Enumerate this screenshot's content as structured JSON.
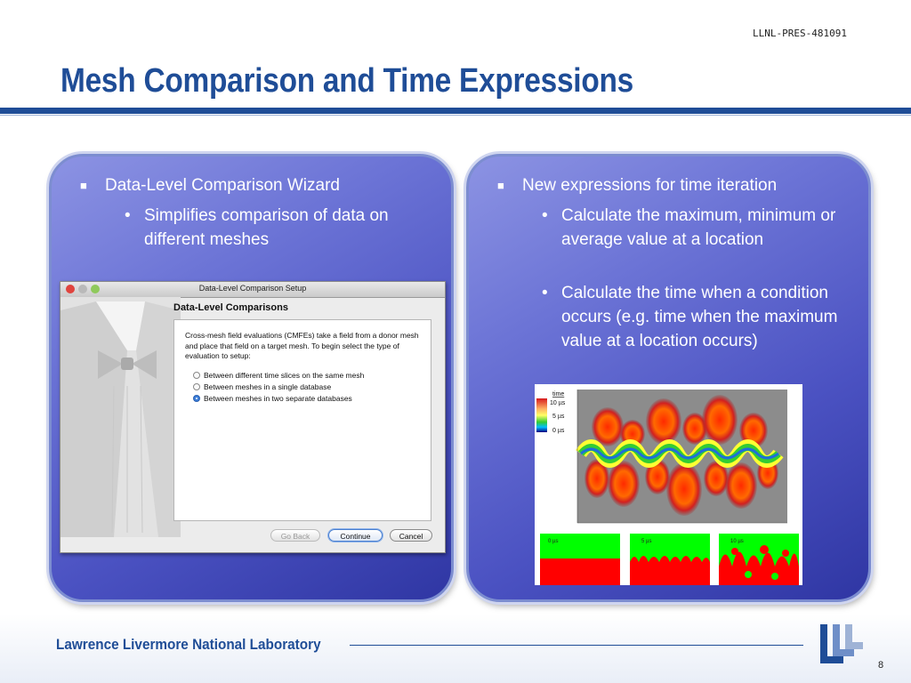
{
  "doc_id": "LLNL-PRES-481091",
  "title": "Mesh Comparison and Time Expressions",
  "left_panel": {
    "bullet": "Data-Level Comparison Wizard",
    "subbullets": [
      "Simplifies comparison of data on different meshes"
    ]
  },
  "right_panel": {
    "bullet": "New expressions for time iteration",
    "subbullets": [
      "Calculate the maximum, minimum or average value at a location",
      "Calculate the time when a condition occurs (e.g. time when the maximum value at a location occurs)"
    ]
  },
  "dialog": {
    "window_title": "Data-Level Comparison Setup",
    "heading": "Data-Level Comparisons",
    "description": "Cross-mesh field evaluations (CMFEs) take a field from a donor mesh and place that field on a target mesh.  To begin select the type of evaluation to setup:",
    "options": [
      {
        "label": "Between different time slices on the same mesh",
        "selected": false
      },
      {
        "label": "Between meshes in a single database",
        "selected": false
      },
      {
        "label": "Between meshes in two separate databases",
        "selected": true
      }
    ],
    "buttons": {
      "back": "Go Back",
      "continue": "Continue",
      "cancel": "Cancel"
    }
  },
  "figure": {
    "legend_title": "time",
    "legend_labels": [
      "10 µs",
      "5 µs",
      "0 µs"
    ],
    "snapshots": [
      "0 µs",
      "5 µs",
      "10 µs"
    ]
  },
  "colors": {
    "brand_blue": "#1f4d97",
    "panel_blue": "#4b52c2"
  },
  "footer": {
    "lab_name": "Lawrence Livermore National Laboratory",
    "page_number": "8"
  }
}
